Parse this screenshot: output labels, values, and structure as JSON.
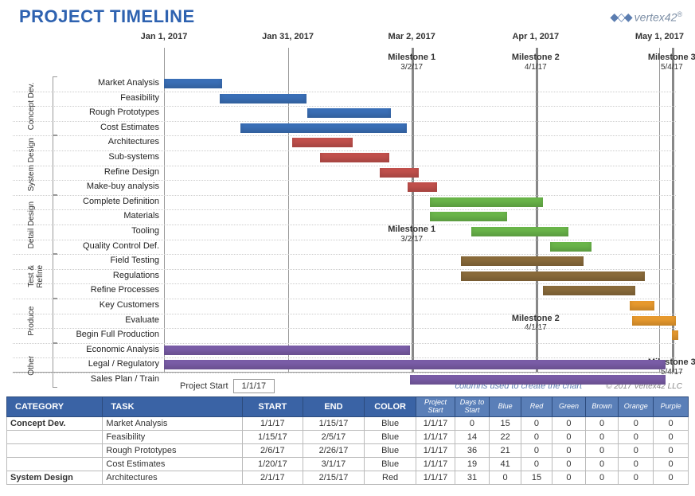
{
  "title": "PROJECT TIMELINE",
  "logo": {
    "text": "vertex",
    "suffix": "42",
    "reg": "®"
  },
  "meta": {
    "project_start_label": "Project Start",
    "project_start_value": "1/1/17",
    "hint": "columns used to create the chart",
    "copyright": "© 2017 Vertex42 LLC"
  },
  "chart_data": {
    "type": "bar",
    "title": "PROJECT TIMELINE",
    "xlabel": "",
    "ylabel": "",
    "x_ticks": [
      {
        "label": "Jan 1, 2017",
        "pos": 0.0
      },
      {
        "label": "Jan 31, 2017",
        "pos": 0.242
      },
      {
        "label": "Mar 2, 2017",
        "pos": 0.484
      },
      {
        "label": "Apr 1, 2017",
        "pos": 0.726
      },
      {
        "label": "May 1, 2017",
        "pos": 0.968
      }
    ],
    "milestones": [
      {
        "name": "Milestone 1",
        "date": "3/2/17",
        "pos": 0.484,
        "callout_row": 10
      },
      {
        "name": "Milestone 2",
        "date": "4/1/17",
        "pos": 0.726,
        "callout_row": 16
      },
      {
        "name": "Milestone 3",
        "date": "5/4/17",
        "pos": 0.992,
        "callout_row": 19
      }
    ],
    "groups": [
      {
        "name": "Concept Dev.",
        "start_row": 0,
        "end_row": 3
      },
      {
        "name": "System Design",
        "start_row": 4,
        "end_row": 7
      },
      {
        "name": "Detail Design",
        "start_row": 8,
        "end_row": 11
      },
      {
        "name": "Test & Refine",
        "start_row": 12,
        "end_row": 14
      },
      {
        "name": "Produce",
        "start_row": 15,
        "end_row": 17
      },
      {
        "name": "Other",
        "start_row": 18,
        "end_row": 20
      }
    ],
    "tasks": [
      {
        "label": "Market Analysis",
        "color": "blue",
        "start": 0.0,
        "dur": 0.113
      },
      {
        "label": "Feasibility",
        "color": "blue",
        "start": 0.109,
        "dur": 0.17
      },
      {
        "label": "Rough Prototypes",
        "color": "blue",
        "start": 0.28,
        "dur": 0.163
      },
      {
        "label": "Cost Estimates",
        "color": "blue",
        "start": 0.15,
        "dur": 0.325
      },
      {
        "label": "Architectures",
        "color": "red",
        "start": 0.25,
        "dur": 0.118
      },
      {
        "label": "Sub-systems",
        "color": "red",
        "start": 0.305,
        "dur": 0.135
      },
      {
        "label": "Refine Design",
        "color": "red",
        "start": 0.422,
        "dur": 0.075
      },
      {
        "label": "Make-buy analysis",
        "color": "red",
        "start": 0.476,
        "dur": 0.058
      },
      {
        "label": "Complete Definition",
        "color": "green",
        "start": 0.52,
        "dur": 0.22
      },
      {
        "label": "Materials",
        "color": "green",
        "start": 0.52,
        "dur": 0.15
      },
      {
        "label": "Tooling",
        "color": "green",
        "start": 0.6,
        "dur": 0.19
      },
      {
        "label": "Quality Control Def.",
        "color": "green",
        "start": 0.755,
        "dur": 0.08
      },
      {
        "label": "Field Testing",
        "color": "brown",
        "start": 0.58,
        "dur": 0.24
      },
      {
        "label": "Regulations",
        "color": "brown",
        "start": 0.58,
        "dur": 0.36
      },
      {
        "label": "Refine Processes",
        "color": "brown",
        "start": 0.74,
        "dur": 0.18
      },
      {
        "label": "Key Customers",
        "color": "orange",
        "start": 0.91,
        "dur": 0.048
      },
      {
        "label": "Evaluate",
        "color": "orange",
        "start": 0.915,
        "dur": 0.085
      },
      {
        "label": "Begin Full Production",
        "color": "orange",
        "start": 0.992,
        "dur": 0.012
      },
      {
        "label": "Economic Analysis",
        "color": "purple",
        "start": 0.0,
        "dur": 0.48
      },
      {
        "label": "Legal / Regulatory",
        "color": "purple",
        "start": 0.0,
        "dur": 0.98
      },
      {
        "label": "Sales Plan / Train",
        "color": "purple",
        "start": 0.48,
        "dur": 0.5
      }
    ]
  },
  "table": {
    "headers": {
      "category": "CATEGORY",
      "task": "TASK",
      "start": "START",
      "end": "END",
      "colorh": "COLOR",
      "ps": "Project Start",
      "dts": "Days to Start",
      "blue": "Blue",
      "red": "Red",
      "green": "Green",
      "brown": "Brown",
      "orange": "Orange",
      "purple": "Purple"
    },
    "rows": [
      {
        "category": "Concept Dev.",
        "task": "Market Analysis",
        "start": "1/1/17",
        "end": "1/15/17",
        "color": "Blue",
        "ps": "1/1/17",
        "dts": 0,
        "blue": 15,
        "red": 0,
        "green": 0,
        "brown": 0,
        "orange": 0,
        "purple": 0
      },
      {
        "category": "",
        "task": "Feasibility",
        "start": "1/15/17",
        "end": "2/5/17",
        "color": "Blue",
        "ps": "1/1/17",
        "dts": 14,
        "blue": 22,
        "red": 0,
        "green": 0,
        "brown": 0,
        "orange": 0,
        "purple": 0
      },
      {
        "category": "",
        "task": "Rough Prototypes",
        "start": "2/6/17",
        "end": "2/26/17",
        "color": "Blue",
        "ps": "1/1/17",
        "dts": 36,
        "blue": 21,
        "red": 0,
        "green": 0,
        "brown": 0,
        "orange": 0,
        "purple": 0
      },
      {
        "category": "",
        "task": "Cost Estimates",
        "start": "1/20/17",
        "end": "3/1/17",
        "color": "Blue",
        "ps": "1/1/17",
        "dts": 19,
        "blue": 41,
        "red": 0,
        "green": 0,
        "brown": 0,
        "orange": 0,
        "purple": 0
      },
      {
        "category": "System Design",
        "task": "Architectures",
        "start": "2/1/17",
        "end": "2/15/17",
        "color": "Red",
        "ps": "1/1/17",
        "dts": 31,
        "blue": 0,
        "red": 15,
        "green": 0,
        "brown": 0,
        "orange": 0,
        "purple": 0
      }
    ]
  }
}
